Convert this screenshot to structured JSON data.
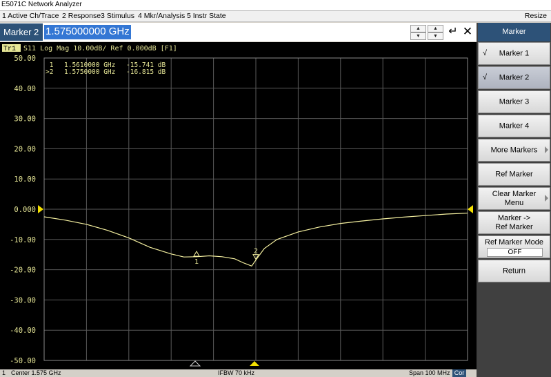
{
  "window": {
    "title": "E5071C Network Analyzer"
  },
  "menu": {
    "items": [
      "1 Active Ch/Trace",
      "2 Response",
      "3 Stimulus",
      "4 Mkr/Analysis",
      "5 Instr State"
    ],
    "resize": "Resize"
  },
  "entry": {
    "label": "Marker 2",
    "value": "1.575000000 GHz"
  },
  "trace": {
    "tag": "Tr1",
    "header": "S11 Log Mag 10.00dB/ Ref 0.000dB [F1]",
    "y_ticks": [
      "50.00",
      "40.00",
      "30.00",
      "20.00",
      "10.00",
      "0.000",
      "-10.00",
      "-20.00",
      "-30.00",
      "-40.00",
      "-50.00"
    ],
    "markers_readout": [
      {
        "prefix": " 1",
        "freq": "1.5610000 GHz",
        "value": "-15.741 dB"
      },
      {
        "prefix": ">2",
        "freq": "1.5750000 GHz",
        "value": "-16.815 dB"
      }
    ],
    "marker_labels": [
      "1",
      "2"
    ],
    "colors": {
      "trace": "#f5f0a0",
      "grid": "#5a5a5a",
      "text": "#e6e696",
      "marker_ref": "#f3df00"
    }
  },
  "chart_data": {
    "type": "line",
    "title": "S11 Log Mag 10.00dB/ Ref 0.000dB [F1]",
    "xlabel": "",
    "ylabel": "",
    "x_unit": "GHz",
    "xlim": [
      1.525,
      1.625
    ],
    "ylim": [
      -50,
      50
    ],
    "grid": true,
    "series": [
      {
        "x": [
          1.525,
          1.53,
          1.535,
          1.54,
          1.545,
          1.55,
          1.555,
          1.558,
          1.561,
          1.564,
          1.567,
          1.57,
          1.572,
          1.574,
          1.575,
          1.577,
          1.58,
          1.585,
          1.59,
          1.595,
          1.6,
          1.605,
          1.61,
          1.615,
          1.62,
          1.625
        ],
        "y": [
          -2.5,
          -3.6,
          -5.0,
          -7.0,
          -9.5,
          -12.6,
          -14.8,
          -15.8,
          -15.7,
          -15.4,
          -15.7,
          -16.4,
          -17.7,
          -18.8,
          -16.8,
          -13.0,
          -10.0,
          -7.5,
          -5.9,
          -4.7,
          -3.9,
          -3.2,
          -2.6,
          -2.1,
          -1.6,
          -1.3
        ]
      }
    ],
    "markers": [
      {
        "id": "1",
        "x": 1.561,
        "y": -15.741
      },
      {
        "id": "2",
        "x": 1.575,
        "y": -16.815
      }
    ]
  },
  "status": {
    "channel": "1",
    "center": "Center 1.575 GHz",
    "ifbw": "IFBW 70 kHz",
    "span": "Span 100 MHz",
    "cor": "Cor"
  },
  "softkeys": {
    "title": "Marker",
    "buttons": [
      {
        "label": "Marker 1",
        "check": "√"
      },
      {
        "label": "Marker 2",
        "check": "√"
      },
      {
        "label": "Marker 3"
      },
      {
        "label": "Marker 4"
      },
      {
        "label": "More Markers"
      },
      {
        "label": "Ref Marker"
      },
      {
        "label_line1": "Clear Marker",
        "label_line2": "Menu"
      },
      {
        "label_line1": "Marker ->",
        "label_line2": "Ref Marker"
      },
      {
        "label": "Ref Marker Mode",
        "value": "OFF"
      },
      {
        "label": "Return"
      }
    ]
  }
}
